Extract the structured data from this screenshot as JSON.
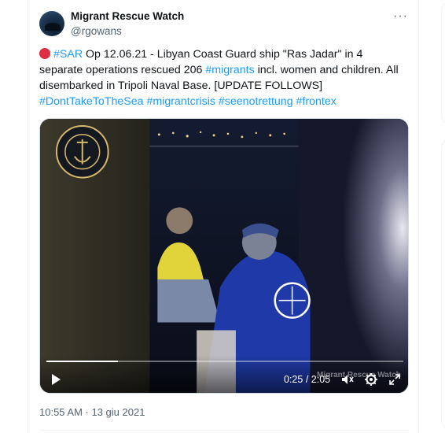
{
  "tweet": {
    "author_name": "Migrant Rescue Watch",
    "author_handle": "@rgowans",
    "more_label": "···",
    "text_parts": {
      "tag_sar": "#SAR",
      "line1": " Op 12.06.21 - Libyan Coast Guard ship \"Ras Jadar\" in 4 separate operations rescued 206 ",
      "tag_migrants": "#migrants",
      "line2": " incl. women and children. All disembarked in Tripoli Naval Base. [UPDATE FOLLOWS] ",
      "tag_dont": "#DontTakeToTheSea",
      "tag_crisis": "#migrantcrisis",
      "tag_seenot": "#seenotrettung",
      "tag_frontex": "#frontex"
    },
    "timestamp": "10:55 AM · 13 giu 2021"
  },
  "video": {
    "current_time": "0:25",
    "separator": " / ",
    "duration": "2:05",
    "progress": 0.2,
    "watermark": "Migrant Rescue Watch",
    "icons": [
      "play-icon",
      "volume-icon",
      "settings-icon",
      "fullscreen-icon"
    ]
  },
  "colors": {
    "accent": "#1d9bf0",
    "text": "#0f1419",
    "muted": "#536471",
    "status_dot": "#dd2e44"
  }
}
